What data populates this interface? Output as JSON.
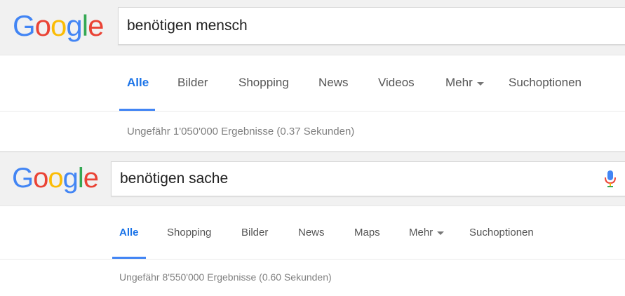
{
  "colors": {
    "google_blue": "#4285F4",
    "google_red": "#EA4335",
    "google_yellow": "#FBBC05",
    "google_green": "#34A853",
    "tab_active": "#1A73E8",
    "header_bg": "#F1F1F1"
  },
  "panel1": {
    "logo": [
      "G",
      "o",
      "o",
      "g",
      "l",
      "e"
    ],
    "query": "benötigen mensch",
    "tabs": [
      {
        "label": "Alle"
      },
      {
        "label": "Bilder"
      },
      {
        "label": "Shopping"
      },
      {
        "label": "News"
      },
      {
        "label": "Videos"
      },
      {
        "label": "Mehr"
      },
      {
        "label": "Suchoptionen"
      }
    ],
    "active_tab": "Alle",
    "result_stats": "Ungefähr 1'050'000 Ergebnisse (0.37 Sekunden)"
  },
  "panel2": {
    "logo": [
      "G",
      "o",
      "o",
      "g",
      "l",
      "e"
    ],
    "query": "benötigen sache",
    "mic_icon": "microphone-icon",
    "tabs": [
      {
        "label": "Alle"
      },
      {
        "label": "Shopping"
      },
      {
        "label": "Bilder"
      },
      {
        "label": "News"
      },
      {
        "label": "Maps"
      },
      {
        "label": "Mehr"
      },
      {
        "label": "Suchoptionen"
      }
    ],
    "active_tab": "Alle",
    "result_stats": "Ungefähr 8'550'000 Ergebnisse (0.60 Sekunden)"
  }
}
